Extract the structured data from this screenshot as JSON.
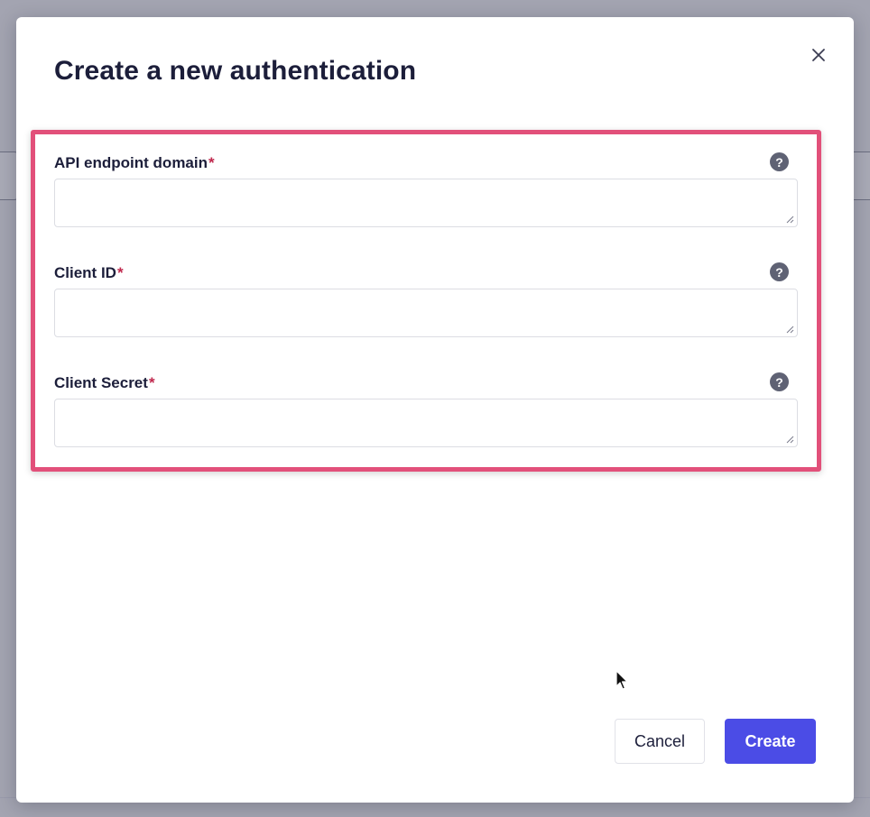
{
  "dialog": {
    "title": "Create a new authentication",
    "close_icon": "close-icon",
    "fields": [
      {
        "label": "API endpoint domain",
        "required_mark": "*",
        "help_icon": "?",
        "value": ""
      },
      {
        "label": "Client ID",
        "required_mark": "*",
        "help_icon": "?",
        "value": ""
      },
      {
        "label": "Client Secret",
        "required_mark": "*",
        "help_icon": "?",
        "value": ""
      }
    ],
    "buttons": {
      "cancel_label": "Cancel",
      "create_label": "Create"
    }
  },
  "colors": {
    "overlay": "#a3a4b1",
    "highlight_border": "#e2507a",
    "primary_button": "#4b4ce6",
    "required_mark": "#c0284d",
    "title_text": "#1c1e3a"
  }
}
